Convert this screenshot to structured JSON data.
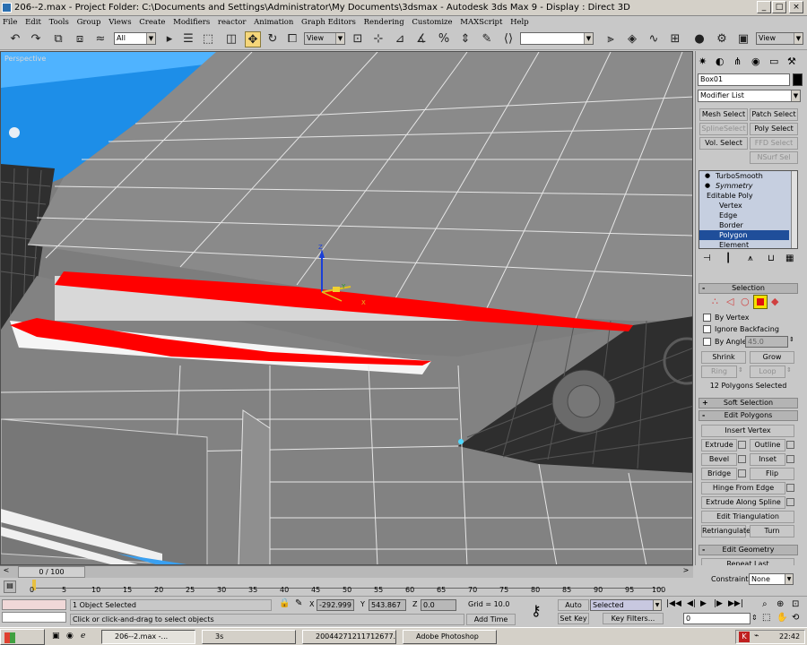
{
  "window": {
    "title": "206--2.max     - Project Folder: C:\\Documents and Settings\\Administrator\\My Documents\\3dsmax     - Autodesk 3ds Max 9     - Display : Direct 3D",
    "min": "_",
    "max": "□",
    "close": "×"
  },
  "menu": [
    "File",
    "Edit",
    "Tools",
    "Group",
    "Views",
    "Create",
    "Modifiers",
    "reactor",
    "Animation",
    "Graph Editors",
    "Rendering",
    "Customize",
    "MAXScript",
    "Help"
  ],
  "toolbar": {
    "selection_filter": "All",
    "ref_coord": "View",
    "named_selection": "",
    "render_view": "View"
  },
  "viewport": {
    "label": "Perspective",
    "gizmo_x": "X",
    "gizmo_y": "Y",
    "gizmo_z": "Z"
  },
  "command_panel": {
    "object_name": "Box01",
    "modifier_list": "Modifier List",
    "buttons": {
      "mesh_select": "Mesh Select",
      "patch_select": "Patch Select",
      "spline_select": "SplineSelect",
      "poly_select": "Poly Select",
      "vol_select": "Vol. Select",
      "ffd_select": "FFD Select",
      "nsurf_sel": "NSurf Sel"
    },
    "stack": [
      {
        "label": "TurboSmooth"
      },
      {
        "label": "Symmetry"
      },
      {
        "label": "Editable Poly"
      },
      {
        "label": "Vertex"
      },
      {
        "label": "Edge"
      },
      {
        "label": "Border"
      },
      {
        "label": "Polygon"
      },
      {
        "label": "Element"
      }
    ],
    "selection": {
      "title": "Selection",
      "by_vertex": "By Vertex",
      "ignore_backfacing": "Ignore Backfacing",
      "by_angle": "By Angle:",
      "angle_value": "45.0",
      "shrink": "Shrink",
      "grow": "Grow",
      "ring": "Ring",
      "loop": "Loop",
      "status": "12 Polygons Selected"
    },
    "soft_selection": "Soft Selection",
    "edit_polygons": {
      "title": "Edit Polygons",
      "insert_vertex": "Insert Vertex",
      "extrude": "Extrude",
      "outline": "Outline",
      "bevel": "Bevel",
      "inset": "Inset",
      "bridge": "Bridge",
      "flip": "Flip",
      "hinge_from_edge": "Hinge From Edge",
      "extrude_along_spline": "Extrude Along Spline",
      "edit_triangulation": "Edit Triangulation",
      "retriangulate": "Retriangulate",
      "turn": "Turn"
    },
    "edit_geometry": {
      "title": "Edit Geometry",
      "repeat_last": "Repeat Last",
      "constraints_label": "Constraints:",
      "constraints_value": "None"
    }
  },
  "timeline": {
    "frame_label": "0 / 100",
    "ticks": [
      "0",
      "5",
      "10",
      "15",
      "20",
      "25",
      "30",
      "35",
      "40",
      "45",
      "50",
      "55",
      "60",
      "65",
      "70",
      "75",
      "80",
      "85",
      "90",
      "95",
      "100"
    ]
  },
  "status": {
    "selected": "1 Object Selected",
    "prompt": "Click or click-and-drag to select objects",
    "x_label": "X",
    "x_value": "-292.999",
    "y_label": "Y",
    "y_value": "543.867",
    "z_label": "Z",
    "z_value": "0.0",
    "grid": "Grid = 10.0",
    "add_time_tag": "Add Time Tag",
    "auto_key": "Auto Key",
    "set_key": "Set Key",
    "key_mode": "Selected",
    "key_filters": "Key Filters...",
    "current_frame": "0"
  },
  "taskbar": {
    "tasks": [
      "206--2.max    -...",
      "3s",
      "20044271211712677.j...",
      "Adobe Photoshop"
    ],
    "clock": "22:42"
  },
  "colors": {
    "selection_red": "#ff0000",
    "active_tool": "#f5d67a",
    "stack_highlight": "#1f4e9a"
  }
}
